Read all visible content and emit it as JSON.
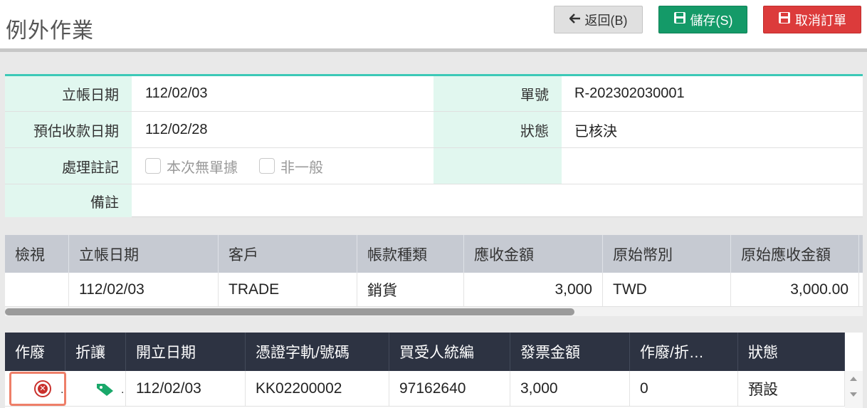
{
  "header": {
    "title": "例外作業",
    "back_label": "返回(B)",
    "save_label": "儲存(S)",
    "cancel_label": "取消訂單",
    "icons": {
      "back": "arrow-left-icon",
      "save": "floppy-disk-icon",
      "cancel": "floppy-disk-icon"
    },
    "colors": {
      "save": "#149a68",
      "cancel": "#dc3b3b",
      "accent": "#3cc9b7"
    }
  },
  "form": {
    "rows": [
      {
        "label": "立帳日期",
        "value": "112/02/03",
        "label2": "單號",
        "value2": "R-202302030001"
      },
      {
        "label": "預估收款日期",
        "value": "112/02/28",
        "label2": "狀態",
        "value2": "已核決"
      },
      {
        "label": "處理註記",
        "check1": "本次無單據",
        "check2": "非一般",
        "label2": "",
        "value2": ""
      },
      {
        "label": "備註",
        "value": ""
      }
    ]
  },
  "grid1": {
    "columns": [
      "檢視",
      "立帳日期",
      "客戶",
      "帳款種類",
      "應收金額",
      "原始幣別",
      "原始應收金額"
    ],
    "rows": [
      [
        "",
        "112/02/03",
        "TRADE",
        "銷貨",
        "3,000",
        "TWD",
        "3,000.00"
      ]
    ]
  },
  "grid2": {
    "columns": [
      "作廢",
      "折讓",
      "開立日期",
      "憑證字軌/號碼",
      "買受人統編",
      "發票金額",
      "作廢/折…",
      "狀態"
    ],
    "rows": [
      [
        "",
        "",
        "112/02/03",
        "KK02200002",
        "97162640",
        "3,000",
        "0",
        "預設"
      ]
    ],
    "icons": {
      "void": "cancel-circle-icon",
      "discount": "tag-icon"
    }
  }
}
